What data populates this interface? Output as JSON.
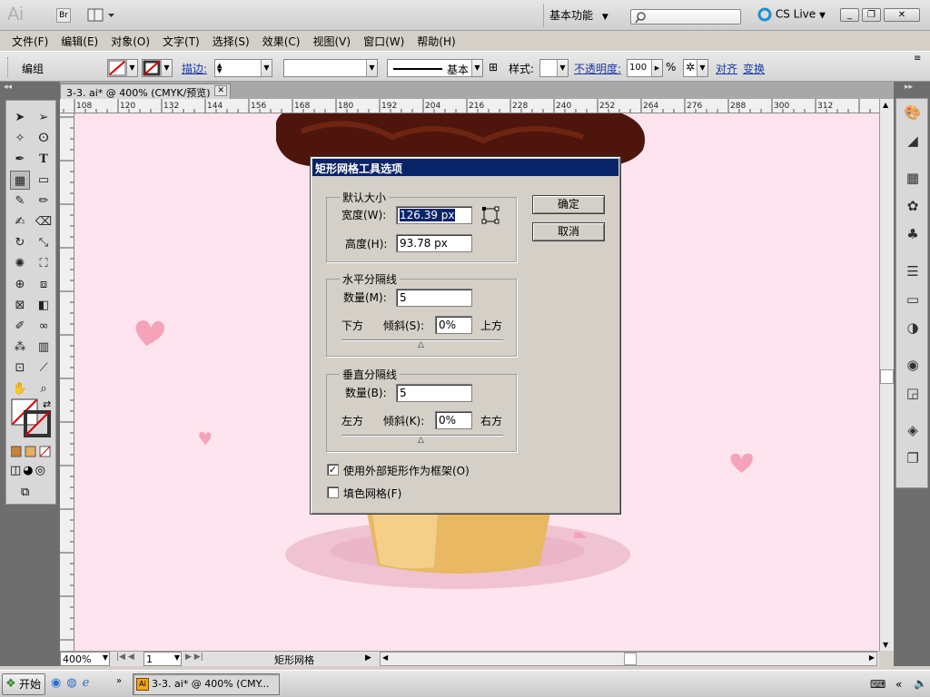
{
  "app": {
    "logo": "Ai",
    "bridge_btn": "Br",
    "workspace": "基本功能",
    "cslive": "CS Live",
    "win_minimize": "_",
    "win_restore": "❐",
    "win_close": "✕"
  },
  "menubar": {
    "items": [
      "文件(F)",
      "编辑(E)",
      "对象(O)",
      "文字(T)",
      "选择(S)",
      "效果(C)",
      "视图(V)",
      "窗口(W)",
      "帮助(H)"
    ]
  },
  "controlbar": {
    "mode": "编组",
    "stroke_label": "描边:",
    "stroke_profile": "基本",
    "style_label": "样式:",
    "opacity_label": "不透明度:",
    "opacity_value": "100",
    "opacity_unit": "%",
    "align_label": "对齐",
    "transform_label": "变换"
  },
  "document": {
    "tab_title": "3-3. ai* @ 400% (CMYK/预览)",
    "ruler_ticks": [
      "6",
      "108",
      "120",
      "132",
      "144",
      "156",
      "168",
      "180",
      "192",
      "204",
      "216",
      "228",
      "240",
      "252",
      "264",
      "276",
      "288",
      "300",
      "312"
    ],
    "zoom": "400%",
    "page": "1",
    "status_tool": "矩形网格"
  },
  "dialog": {
    "title": "矩形网格工具选项",
    "default_size_label": "默认大小",
    "width_label": "宽度(W):",
    "width_value": "126.39 px",
    "height_label": "高度(H):",
    "height_value": "93.78 px",
    "horizontal_label": "水平分隔线",
    "h_count_label": "数量(M):",
    "h_count_value": "5",
    "h_low": "下方",
    "h_skew_label": "倾斜(S):",
    "h_skew_value": "0%",
    "h_high": "上方",
    "vertical_label": "垂直分隔线",
    "v_count_label": "数量(B):",
    "v_count_value": "5",
    "v_low": "左方",
    "v_skew_label": "倾斜(K):",
    "v_skew_value": "0%",
    "v_high": "右方",
    "use_outer_label": "使用外部矩形作为框架(O)",
    "use_outer_checked": true,
    "fill_grid_label": "填色网格(F)",
    "fill_grid_checked": false,
    "ok_label": "确定",
    "cancel_label": "取消"
  },
  "taskbar": {
    "start_label": "开始",
    "task_label": "3-3. ai* @ 400% (CMY..."
  },
  "colors": {
    "canvas_bg": "#fde4ee",
    "dialog_title_bg": "#0a246a",
    "heart": "#f5a3b8",
    "chocolate": "#5a1a0e",
    "cone": "#e8b862"
  }
}
